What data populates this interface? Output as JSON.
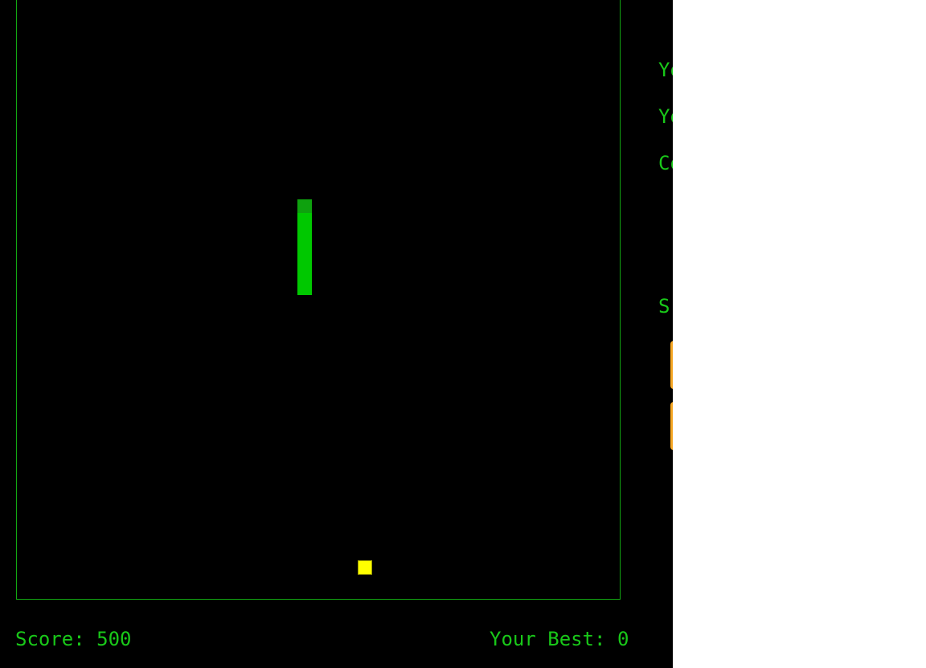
{
  "game": {
    "score_label": "Score: 500",
    "best_label": "Your Best: 0",
    "snake_length": 7,
    "colors": {
      "background": "#000000",
      "border": "#12a812",
      "snake": "#00c800",
      "snake_head": "#0ea10e",
      "food": "#ffff00",
      "text": "#19c819"
    }
  },
  "side_panel": {
    "row_1": "Yo",
    "row_2": "Yo",
    "row_3": "Co",
    "row_4": "S"
  }
}
